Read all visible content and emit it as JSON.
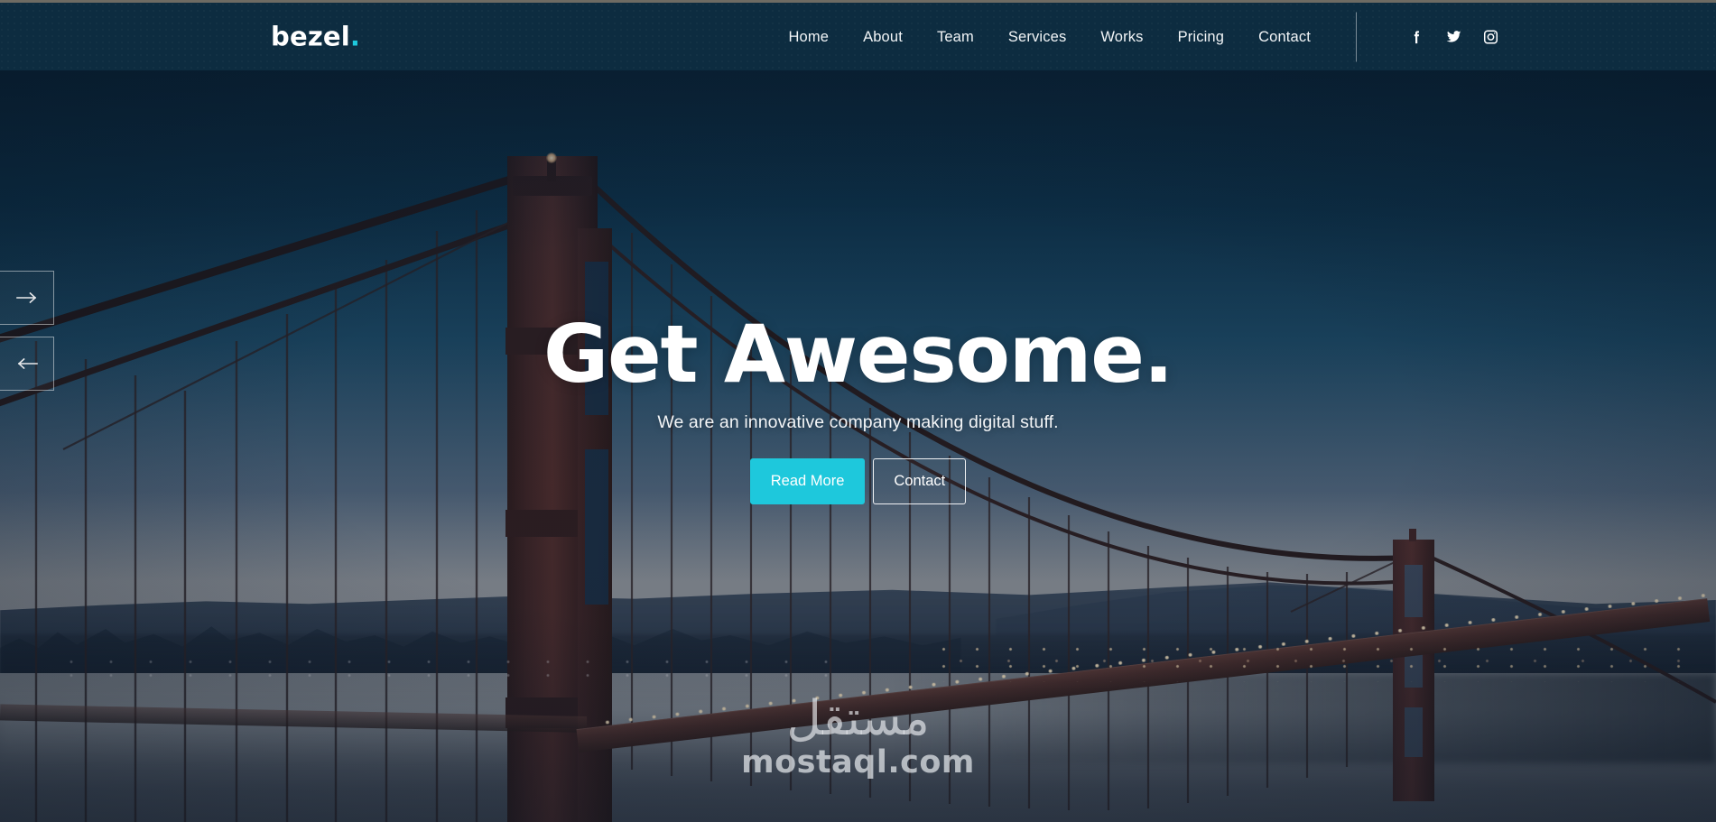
{
  "site": {
    "brand_name": "bezel",
    "brand_dot": "."
  },
  "header": {
    "nav_items": [
      {
        "label": "Home",
        "name": "nav-home"
      },
      {
        "label": "About",
        "name": "nav-about"
      },
      {
        "label": "Team",
        "name": "nav-team"
      },
      {
        "label": "Services",
        "name": "nav-services"
      },
      {
        "label": "Works",
        "name": "nav-works"
      },
      {
        "label": "Pricing",
        "name": "nav-pricing"
      },
      {
        "label": "Contact",
        "name": "nav-contact"
      }
    ],
    "social": [
      {
        "icon": "facebook-icon",
        "label": "Facebook"
      },
      {
        "icon": "twitter-icon",
        "label": "Twitter"
      },
      {
        "icon": "instagram-icon",
        "label": "Instagram"
      }
    ]
  },
  "hero": {
    "title": "Get Awesome.",
    "subtitle": "We are an innovative company making digital stuff.",
    "primary_button": "Read More",
    "secondary_button": "Contact",
    "background_alt": "Golden Gate Bridge at dusk"
  },
  "slider": {
    "next_icon": "arrow-right-icon",
    "prev_icon": "arrow-left-icon"
  },
  "watermark": {
    "arabic": "مستقل",
    "latin": "mostaql.com"
  },
  "colors": {
    "header_bg": "#0d2c40",
    "accent": "#1ec8dc",
    "text_light": "#ffffff",
    "hero_dark": "#0a2438",
    "top_hairline": "#6e6b63"
  }
}
